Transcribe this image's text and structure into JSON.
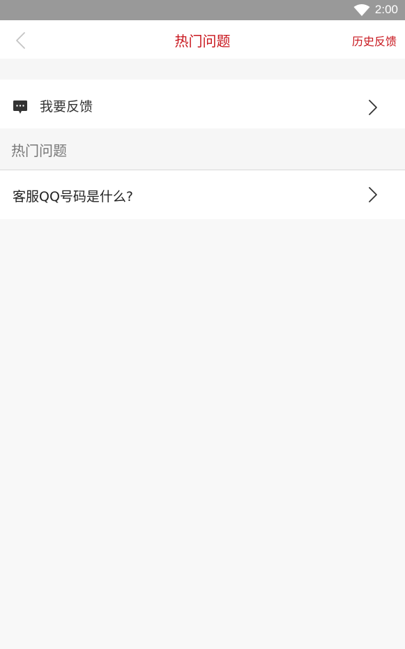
{
  "status_bar": {
    "time": "2:00",
    "icons": [
      "wifi-icon"
    ]
  },
  "nav": {
    "back_icon": "chevron-left-icon",
    "title": "热门问题",
    "history_label": "历史反馈"
  },
  "feedback": {
    "icon": "chat-bubble-icon",
    "label": "我要反馈",
    "chevron_icon": "chevron-right-icon"
  },
  "section": {
    "title": "热门问题"
  },
  "questions": [
    {
      "label": "客服QQ号码是什么?",
      "chevron_icon": "chevron-right-icon"
    }
  ],
  "colors": {
    "accent": "#c8161d",
    "status_bar": "#999999",
    "page_background": "#f8f8f8"
  }
}
